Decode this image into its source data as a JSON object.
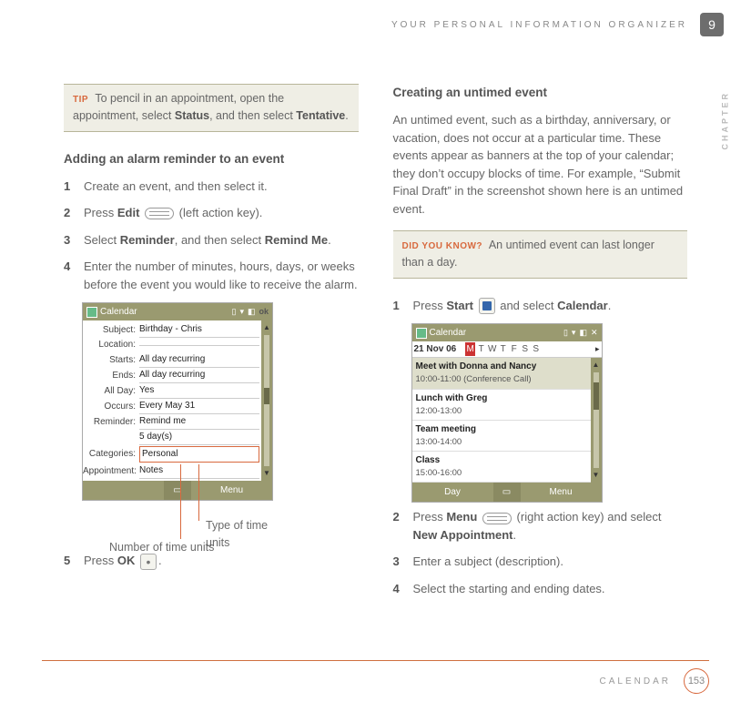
{
  "header": {
    "running_title": "YOUR PERSONAL INFORMATION ORGANIZER",
    "chapter_number": "9",
    "chapter_side": "CHAPTER"
  },
  "left": {
    "tip": {
      "label": "TIP",
      "pre": "To pencil in an appointment, open the appointment, select ",
      "b1": "Status",
      "mid": ", and then select ",
      "b2": "Tentative",
      "post": "."
    },
    "section_title": "Adding an alarm reminder to an event",
    "steps": [
      {
        "raw": "Create an event, and then select it."
      },
      {
        "pre": "Press ",
        "b1": "Edit",
        "icon": "edit-key",
        "post": " (left action key)."
      },
      {
        "pre": "Select ",
        "b1": "Reminder",
        "mid": ", and then select ",
        "b2": "Remind Me",
        "post": "."
      },
      {
        "raw": "Enter the number of minutes, hours, days, or weeks before the event you would like to receive the alarm."
      }
    ],
    "device": {
      "title": "Calendar",
      "ok": "ok",
      "rows": [
        {
          "lbl": "Subject:",
          "val": "Birthday - Chris"
        },
        {
          "lbl": "Location:",
          "val": ""
        },
        {
          "lbl": "Starts:",
          "val": "All day recurring"
        },
        {
          "lbl": "Ends:",
          "val": "All day recurring"
        },
        {
          "lbl": "All Day:",
          "val": "Yes"
        },
        {
          "lbl": "Occurs:",
          "val": "Every May 31"
        },
        {
          "lbl": "Reminder:",
          "val": "Remind me"
        },
        {
          "lbl": "",
          "val": "5     day(s)"
        },
        {
          "lbl": "Categories:",
          "val": "Personal",
          "boxed": true
        },
        {
          "lbl": "Appointment:",
          "val": "Notes"
        }
      ],
      "soft_left": "",
      "soft_right": "Menu"
    },
    "callout1": "Type of time units",
    "callout2": "Number of time units",
    "step5": {
      "pre": "Press ",
      "b1": "OK",
      "icon": "ok-icon",
      "post": "."
    }
  },
  "right": {
    "section_title": "Creating an untimed event",
    "intro": "An untimed event, such as a birthday, anniversary, or vacation, does not occur at a particular time. These events appear as banners at the top of your calendar; they don’t occupy blocks of time. For example, “Submit Final Draft” in the screenshot shown here is an untimed event.",
    "dyk": {
      "label": "DID YOU KNOW?",
      "text": "An untimed event can last longer than a day."
    },
    "steps_a": [
      {
        "pre": "Press ",
        "b1": "Start",
        "icon": "start-icon",
        "mid": " and select ",
        "b2": "Calendar",
        "post": "."
      }
    ],
    "device": {
      "title": "Calendar",
      "date": "21 Nov 06",
      "dow": [
        "M",
        "T",
        "W",
        "T",
        "F",
        "S",
        "S"
      ],
      "dow_sel": 0,
      "items": [
        {
          "t1": "Meet with Donna and Nancy",
          "t2": "10:00-11:00 (Conference Call)",
          "banner": true
        },
        {
          "t1": "Lunch with Greg",
          "t2": "12:00-13:00"
        },
        {
          "t1": "Team meeting",
          "t2": "13:00-14:00"
        },
        {
          "t1": "Class",
          "t2": "15:00-16:00"
        }
      ],
      "soft_left": "Day",
      "soft_right": "Menu"
    },
    "steps_b": [
      {
        "pre": "Press ",
        "b1": "Menu",
        "icon": "menu-key",
        "mid": " (right action key) and select ",
        "b2": "New Appointment",
        "post": "."
      },
      {
        "raw": "Enter a subject (description)."
      },
      {
        "raw": "Select the starting and ending dates."
      }
    ]
  },
  "footer": {
    "section": "CALENDAR",
    "page": "153"
  }
}
